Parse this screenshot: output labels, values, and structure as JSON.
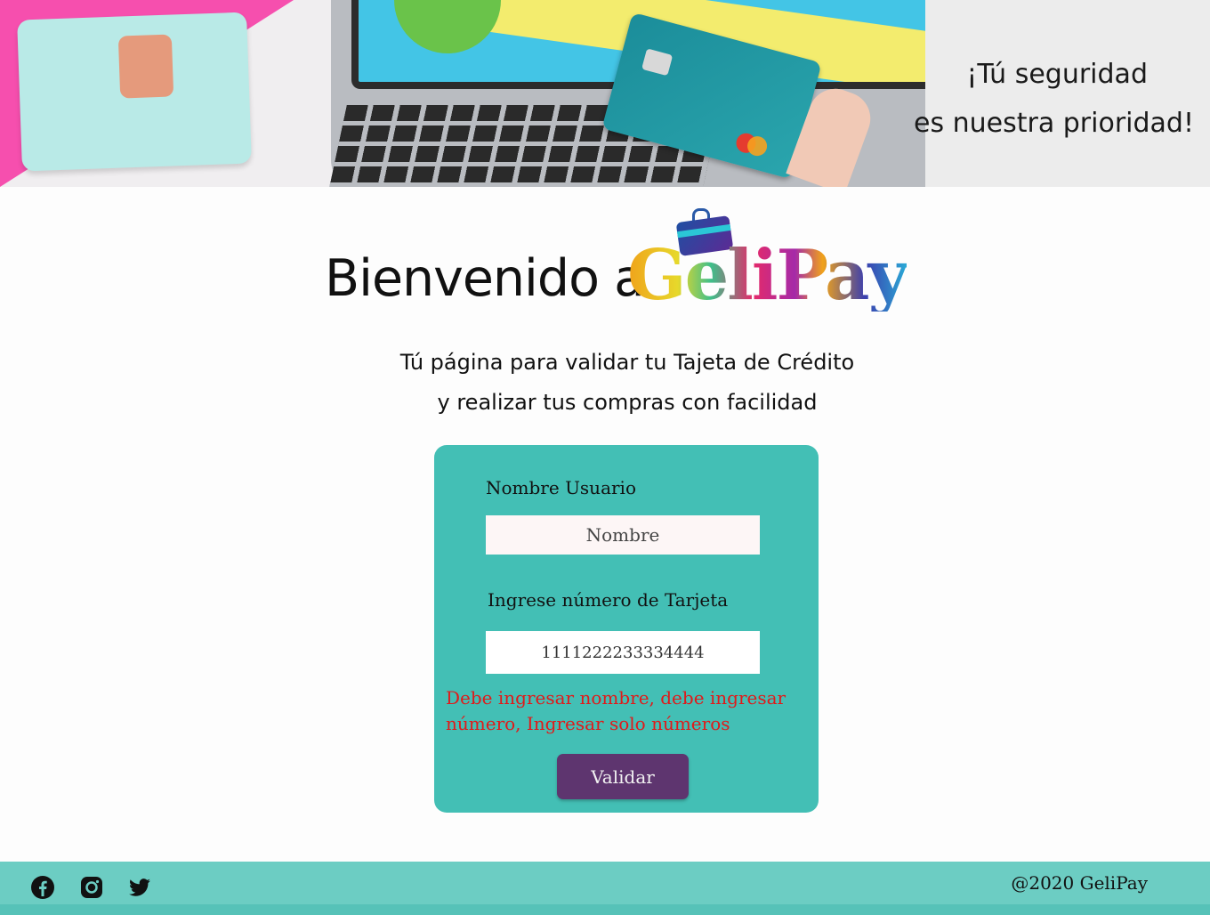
{
  "hero": {
    "slogan_line1": "¡Tú seguridad",
    "slogan_line2": "es nuestra prioridad!"
  },
  "header": {
    "title": "Bienvenido a",
    "brand": "GeliPay",
    "subtitle_line1": "Tú página para validar tu Tajeta de Crédito",
    "subtitle_line2": "y realizar tus compras con facilidad"
  },
  "form": {
    "name_label": "Nombre Usuario",
    "name_placeholder": "Nombre",
    "name_value": "",
    "card_label": "Ingrese número de  Tarjeta",
    "card_value": "1111222233334444",
    "error_message": "Debe ingresar nombre, debe ingresar número, Ingresar solo números",
    "submit_label": "Validar"
  },
  "footer": {
    "social": [
      "facebook-icon",
      "instagram-icon",
      "twitter-icon"
    ],
    "copyright": "@2020 GeliPay"
  },
  "colors": {
    "form_bg": "#43bfb5",
    "button_bg": "#5e356f",
    "error_text": "#e01a1a",
    "footer_bg": "#6ccdc3"
  }
}
